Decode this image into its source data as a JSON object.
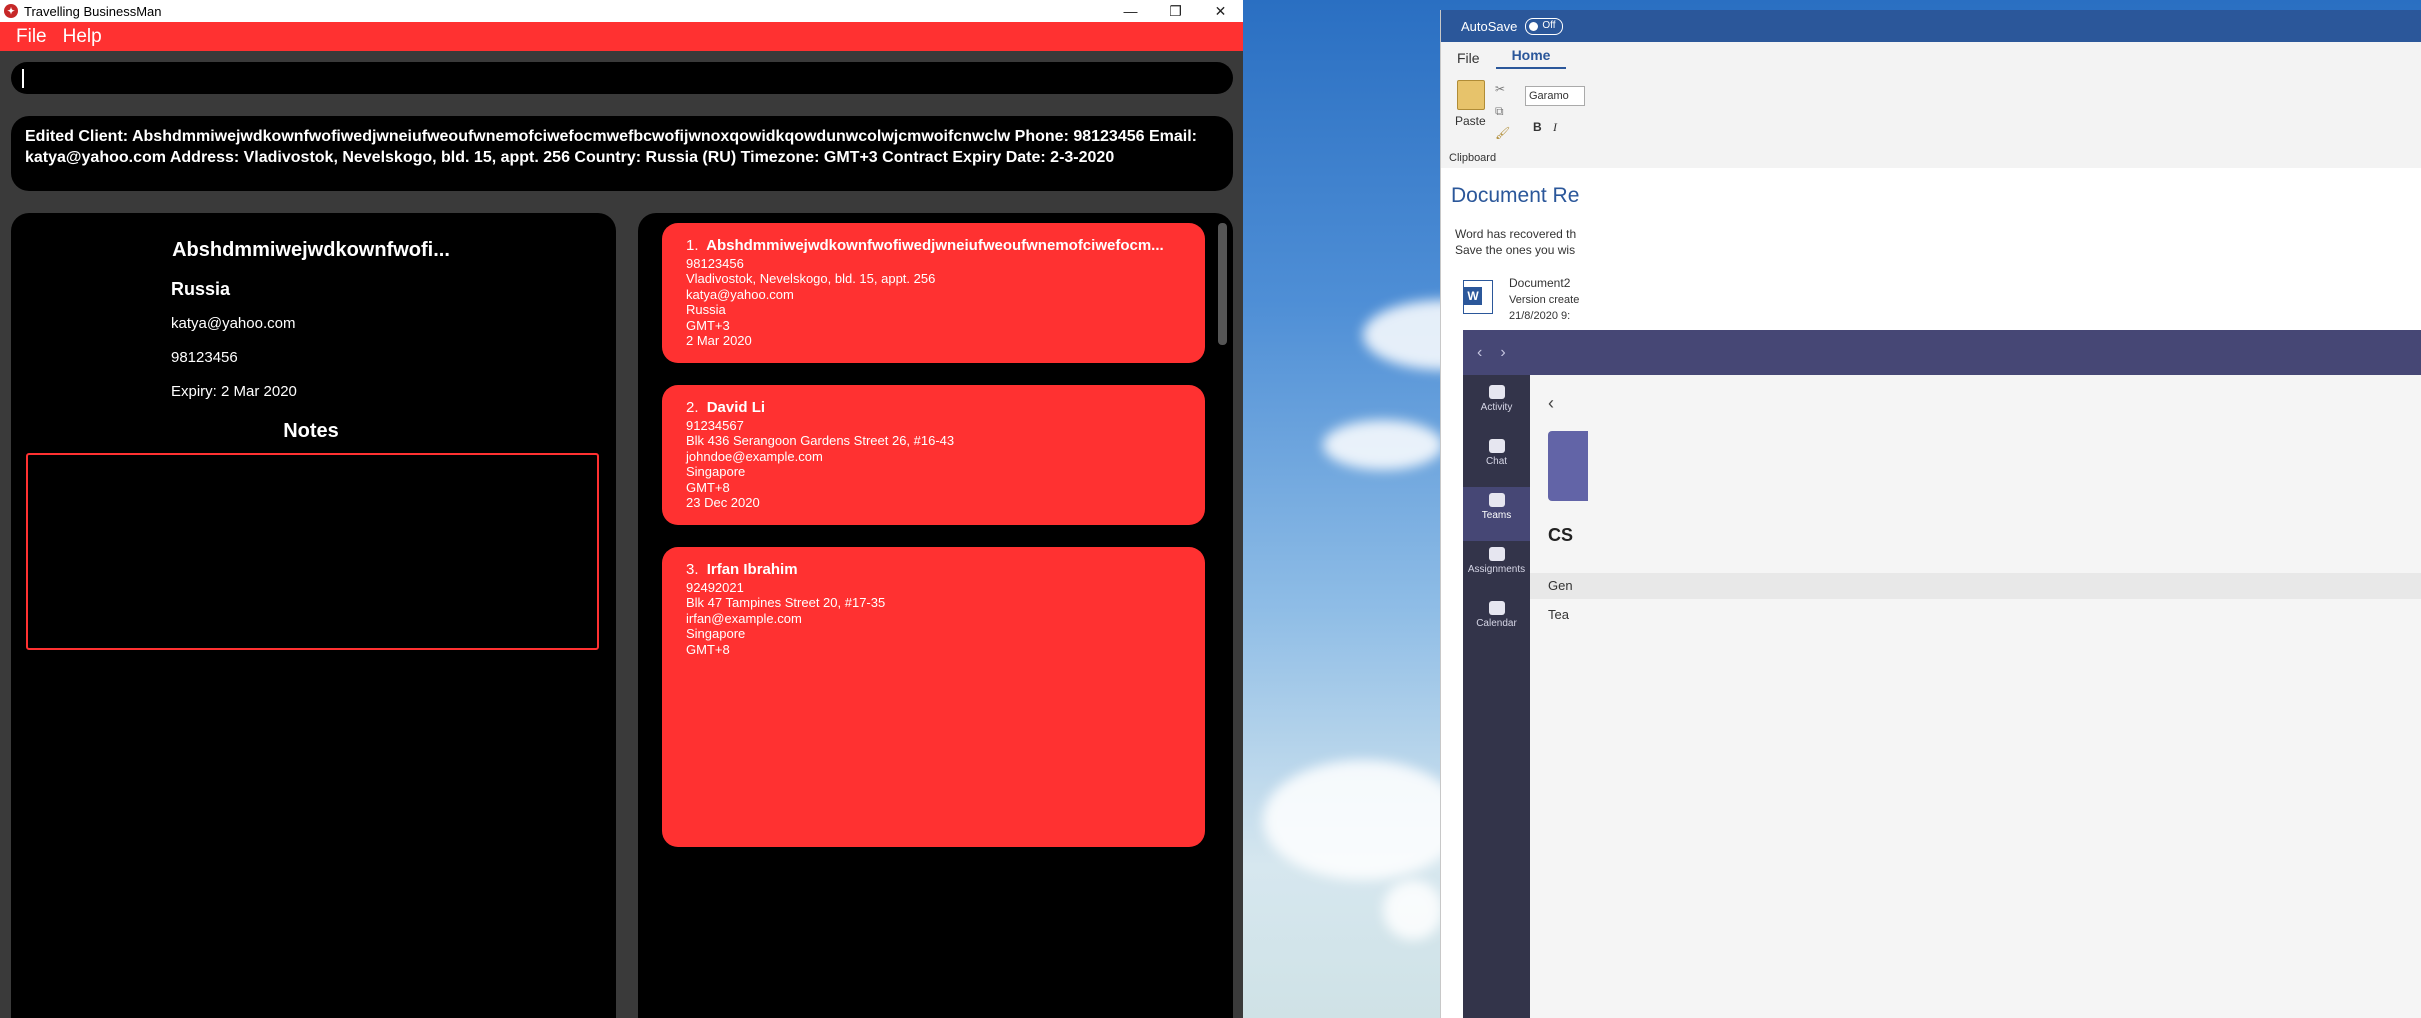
{
  "app": {
    "title": "Travelling BusinessMan",
    "menu": [
      "File",
      "Help"
    ],
    "command_value": "",
    "result": "Edited Client: Abshdmmiwejwdkownfwofiwedjwneiufweoufwnemofciwefocmwefbcwofijwnoxqowidkqowdunwcolwjcmwoifcnwclw Phone: 98123456 Email: katya@yahoo.com Address: Vladivostok, Nevelskogo, bld. 15, appt. 256 Country: Russia (RU) Timezone: GMT+3 Contract Expiry Date: 2-3-2020",
    "detail": {
      "name": "Abshdmmiwejwdkownfwofi...",
      "country": "Russia",
      "email": "katya@yahoo.com",
      "phone": "98123456",
      "expiry": "Expiry: 2 Mar 2020",
      "notes_title": "Notes"
    },
    "clients": [
      {
        "index": "1.",
        "name": "Abshdmmiwejwdkownfwofiwedjwneiufweoufwnemofciwefocm...",
        "phone": "98123456",
        "address": "Vladivostok, Nevelskogo, bld. 15, appt. 256",
        "email": "katya@yahoo.com",
        "country": "Russia",
        "timezone": "GMT+3",
        "expiry": "2 Mar 2020"
      },
      {
        "index": "2.",
        "name": "David Li",
        "phone": "91234567",
        "address": "Blk 436 Serangoon Gardens Street 26, #16-43",
        "email": "johndoe@example.com",
        "country": "Singapore",
        "timezone": "GMT+8",
        "expiry": "23 Dec 2020"
      },
      {
        "index": "3.",
        "name": "Irfan Ibrahim",
        "phone": "92492021",
        "address": "Blk 47 Tampines Street 20, #17-35",
        "email": "irfan@example.com",
        "country": "Singapore",
        "timezone": "GMT+8",
        "expiry": ""
      }
    ],
    "colors": {
      "accent": "#ff3131",
      "panel": "#000000",
      "background": "#3a3a3a"
    }
  },
  "word": {
    "autosave": "AutoSave",
    "toggle": "Off",
    "tabs": [
      "File",
      "Home"
    ],
    "paste": "Paste",
    "clipboard": "Clipboard",
    "font": "Garamo",
    "bold": "B",
    "italic": "I",
    "recovery_title": "Document Re",
    "recovery_line1": "Word has recovered th",
    "recovery_line2": "Save the ones you wis",
    "doc_name": "Document2",
    "doc_version": "Version create",
    "doc_date": "21/8/2020 9:"
  },
  "teams": {
    "rail": [
      "Activity",
      "Chat",
      "Teams",
      "Assignments",
      "Calendar"
    ],
    "content_title": "CS",
    "rows": [
      "Gen",
      "Tea"
    ]
  }
}
